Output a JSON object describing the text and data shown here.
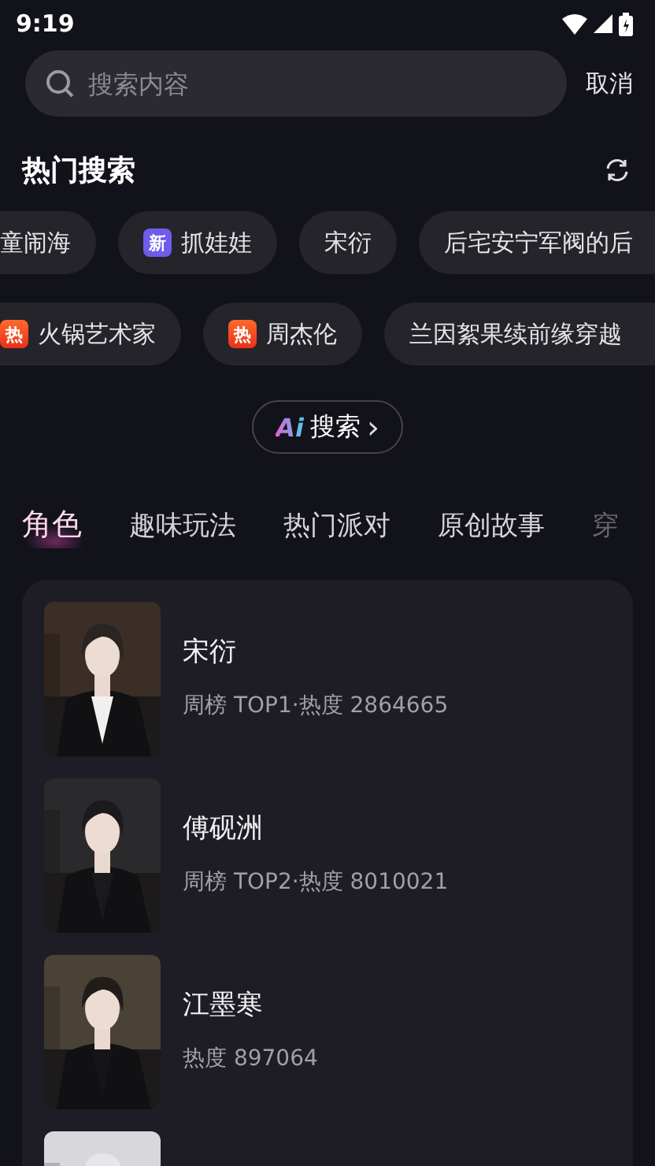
{
  "status_bar": {
    "time": "9:19"
  },
  "search": {
    "placeholder": "搜索内容",
    "cancel": "取消"
  },
  "hot_search": {
    "title": "热门搜索",
    "chip_lines": [
      {
        "chips": [
          {
            "text": "童闹海",
            "clipped_left": true
          },
          {
            "text": "抓娃娃",
            "badge": {
              "kind": "new",
              "text": "新"
            }
          },
          {
            "text": "宋衍"
          },
          {
            "text": "后宅安宁军阀的后",
            "clipped_right": true
          }
        ]
      },
      {
        "chips": [
          {
            "text": "火锅艺术家",
            "badge": {
              "kind": "hot",
              "text": "热"
            },
            "clipped_left": true
          },
          {
            "text": "周杰伦",
            "badge": {
              "kind": "hot",
              "text": "热"
            }
          },
          {
            "text": "兰因絮果续前缘穿越",
            "clipped_right": true
          }
        ]
      }
    ]
  },
  "ai_search": {
    "logo": "Ai",
    "label": "搜索",
    "chevron": "›"
  },
  "tabs": [
    {
      "label": "角色",
      "selected": true,
      "dimmed": false
    },
    {
      "label": "趣味玩法",
      "selected": false,
      "dimmed": false
    },
    {
      "label": "热门派对",
      "selected": false,
      "dimmed": false
    },
    {
      "label": "原创故事",
      "selected": false,
      "dimmed": false
    },
    {
      "label": "穿",
      "selected": false,
      "dimmed": true
    }
  ],
  "characters": [
    {
      "name": "宋衍",
      "stats": "周榜 TOP1·热度 2864665",
      "kind": "picture"
    },
    {
      "name": "傅砚洲",
      "stats": "周榜 TOP2·热度 8010021",
      "kind": "picture"
    },
    {
      "name": "江墨寒",
      "stats": "热度 897064",
      "kind": "picture"
    },
    {
      "kind": "picture"
    }
  ]
}
